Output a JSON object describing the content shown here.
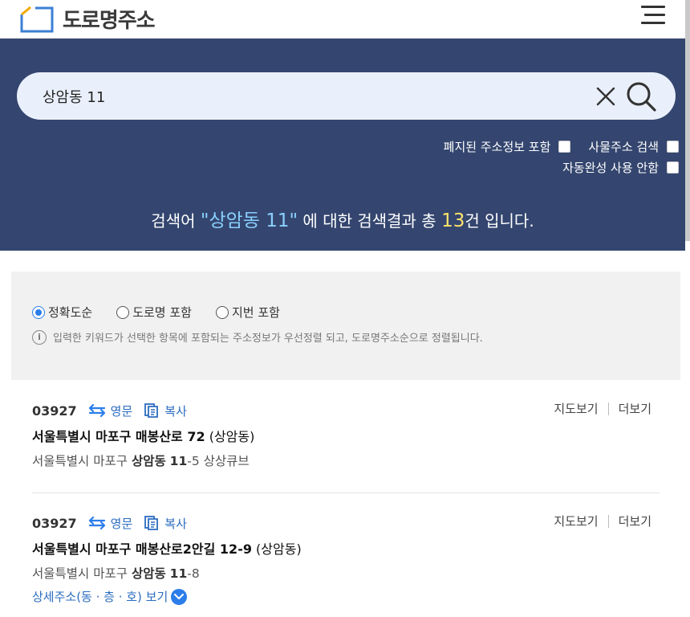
{
  "header": {
    "logo_text": "도로명주소"
  },
  "search": {
    "value": "상암동 11",
    "placeholder": ""
  },
  "options": {
    "include_abolished": "폐지된 주소정보 포함",
    "building_search": "사물주소 검색",
    "autocomplete_off": "자동완성 사용 안함"
  },
  "summary": {
    "prefix": "검색어 ",
    "keyword": "\"상암동 11\"",
    "middle": " 에 대한 검색결과 총 ",
    "count": "13",
    "suffix": "건 입니다."
  },
  "filter": {
    "radios": [
      {
        "label": "정확도순",
        "checked": true
      },
      {
        "label": "도로명 포함",
        "checked": false
      },
      {
        "label": "지번 포함",
        "checked": false
      }
    ],
    "info_icon_text": "i",
    "notice": "입력한 키워드가 선택한 항목에 포함되는 주소정보가 우선정렬 되고, 도로명주소순으로 정렬됩니다."
  },
  "results": [
    {
      "zip": "03927",
      "eng_label": "영문",
      "copy_label": "복사",
      "map_label": "지도보기",
      "more_label": "더보기",
      "road_prefix": "서울특별시 마포구 매봉산로 72",
      "road_dong": " (상암동)",
      "jibun_prefix": "서울특별시 마포구 ",
      "jibun_dong": "상암동",
      "jibun_sep": " ",
      "jibun_main": "11",
      "jibun_rest": "-5 상상큐브"
    },
    {
      "zip": "03927",
      "eng_label": "영문",
      "copy_label": "복사",
      "map_label": "지도보기",
      "more_label": "더보기",
      "road_prefix": "서울특별시 마포구 매봉산로2안길 12-9",
      "road_dong": " (상암동)",
      "jibun_prefix": "서울특별시 마포구 ",
      "jibun_dong": "상암동",
      "jibun_sep": " ",
      "jibun_main": "11",
      "jibun_rest": "-8",
      "detail_label": "상세주소(동 · 층 · 호) 보기"
    }
  ],
  "colors": {
    "hero_bg": "#34466f",
    "keyword": "#8ad0ff",
    "count": "#ffe36b",
    "link_blue": "#2b6cc0"
  }
}
